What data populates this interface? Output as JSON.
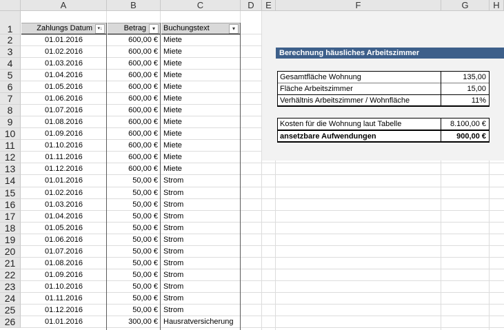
{
  "columns": [
    "A",
    "B",
    "C",
    "D",
    "E",
    "F",
    "G",
    "H"
  ],
  "row_numbers": [
    1,
    2,
    3,
    4,
    5,
    6,
    7,
    8,
    9,
    10,
    11,
    12,
    13,
    14,
    15,
    16,
    17,
    18,
    19,
    20,
    21,
    22,
    23,
    24,
    25,
    26
  ],
  "table": {
    "headers": {
      "date": "Zahlungs Datum",
      "amount": "Betrag",
      "text": "Buchungstext"
    },
    "rows": [
      {
        "date": "01.01.2016",
        "amount": "600,00 €",
        "text": "Miete"
      },
      {
        "date": "01.02.2016",
        "amount": "600,00 €",
        "text": "Miete"
      },
      {
        "date": "01.03.2016",
        "amount": "600,00 €",
        "text": "Miete"
      },
      {
        "date": "01.04.2016",
        "amount": "600,00 €",
        "text": "Miete"
      },
      {
        "date": "01.05.2016",
        "amount": "600,00 €",
        "text": "Miete"
      },
      {
        "date": "01.06.2016",
        "amount": "600,00 €",
        "text": "Miete"
      },
      {
        "date": "01.07.2016",
        "amount": "600,00 €",
        "text": "Miete"
      },
      {
        "date": "01.08.2016",
        "amount": "600,00 €",
        "text": "Miete"
      },
      {
        "date": "01.09.2016",
        "amount": "600,00 €",
        "text": "Miete"
      },
      {
        "date": "01.10.2016",
        "amount": "600,00 €",
        "text": "Miete"
      },
      {
        "date": "01.11.2016",
        "amount": "600,00 €",
        "text": "Miete"
      },
      {
        "date": "01.12.2016",
        "amount": "600,00 €",
        "text": "Miete"
      },
      {
        "date": "01.01.2016",
        "amount": "50,00 €",
        "text": "Strom"
      },
      {
        "date": "01.02.2016",
        "amount": "50,00 €",
        "text": "Strom"
      },
      {
        "date": "01.03.2016",
        "amount": "50,00 €",
        "text": "Strom"
      },
      {
        "date": "01.04.2016",
        "amount": "50,00 €",
        "text": "Strom"
      },
      {
        "date": "01.05.2016",
        "amount": "50,00 €",
        "text": "Strom"
      },
      {
        "date": "01.06.2016",
        "amount": "50,00 €",
        "text": "Strom"
      },
      {
        "date": "01.07.2016",
        "amount": "50,00 €",
        "text": "Strom"
      },
      {
        "date": "01.08.2016",
        "amount": "50,00 €",
        "text": "Strom"
      },
      {
        "date": "01.09.2016",
        "amount": "50,00 €",
        "text": "Strom"
      },
      {
        "date": "01.10.2016",
        "amount": "50,00 €",
        "text": "Strom"
      },
      {
        "date": "01.11.2016",
        "amount": "50,00 €",
        "text": "Strom"
      },
      {
        "date": "01.12.2016",
        "amount": "50,00 €",
        "text": "Strom"
      },
      {
        "date": "01.01.2016",
        "amount": "300,00 €",
        "text": "Hausratversicherung"
      }
    ]
  },
  "calc": {
    "title": "Berechnung häusliches Arbeitszimmer",
    "rows": [
      {
        "label": "Gesamtfläche Wohnung",
        "value": "135,00"
      },
      {
        "label": "Fläche Arbeitszimmer",
        "value": "15,00"
      },
      {
        "label": "Verhältnis Arbeitszimmer / Wohnfläche",
        "value": "11%"
      }
    ],
    "costs": {
      "label": "Kosten für die Wohnung laut Tabelle",
      "value": "8.100,00 €"
    },
    "result": {
      "label": "ansetzbare Aufwendungen",
      "value": "900,00 €"
    }
  },
  "colors": {
    "banner": "#3d5f8a",
    "header": "#e6e6e6",
    "panel": "#f2f2f2",
    "grid": "#d4d4d4"
  },
  "icons": {
    "filter_sorted": "sort-filter-icon",
    "filter": "dropdown-arrow-icon"
  }
}
